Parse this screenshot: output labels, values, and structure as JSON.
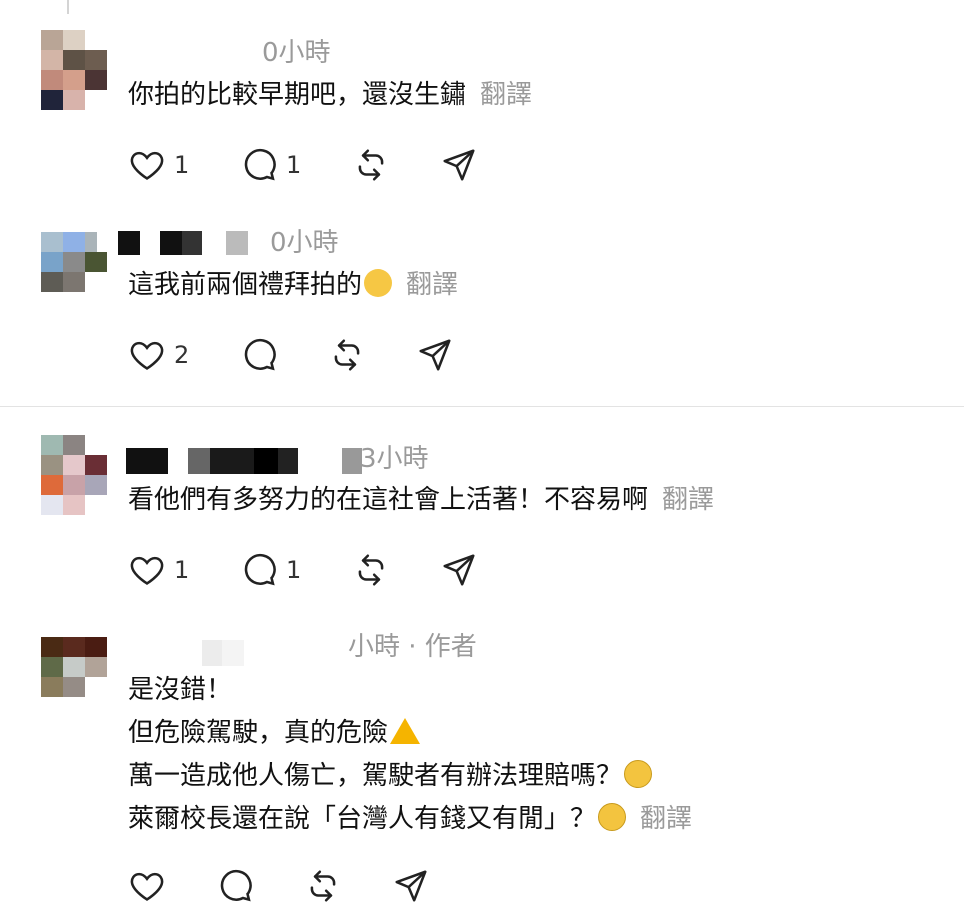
{
  "comments": [
    {
      "time": "0小時",
      "lines": [
        "你拍的比較早期吧，還沒生鏽"
      ],
      "translate": "翻譯",
      "likes": "1",
      "replies": "1"
    },
    {
      "time": "0小時",
      "lines": [
        "這我前兩個禮拜拍的"
      ],
      "translate": "翻譯",
      "likes": "2",
      "replies": ""
    },
    {
      "time": "3小時",
      "lines": [
        "看他們有多努力的在這社會上活著！不容易啊"
      ],
      "translate": "翻譯",
      "likes": "1",
      "replies": "1"
    },
    {
      "time": "小時 · 作者",
      "lines": [
        "是沒錯！",
        "但危險駕駛，真的危險",
        "萬一造成他人傷亡，駕駛者有辦法理賠嗎？",
        "萊爾校長還在說「台灣人有錢又有閒」？"
      ],
      "translate": "翻譯",
      "likes": "",
      "replies": ""
    }
  ],
  "icons": {
    "like": "heart-icon",
    "reply": "speech-bubble-icon",
    "repost": "repost-icon",
    "share": "send-icon",
    "emoji_laugh": "tears-of-joy-emoji",
    "emoji_fear": "fearful-face-emoji",
    "warning": "warning-sign-emoji"
  },
  "colors": {
    "text": "#111111",
    "muted": "#9a9a9a",
    "icon": "#222222",
    "divider": "#e3e3e3"
  }
}
